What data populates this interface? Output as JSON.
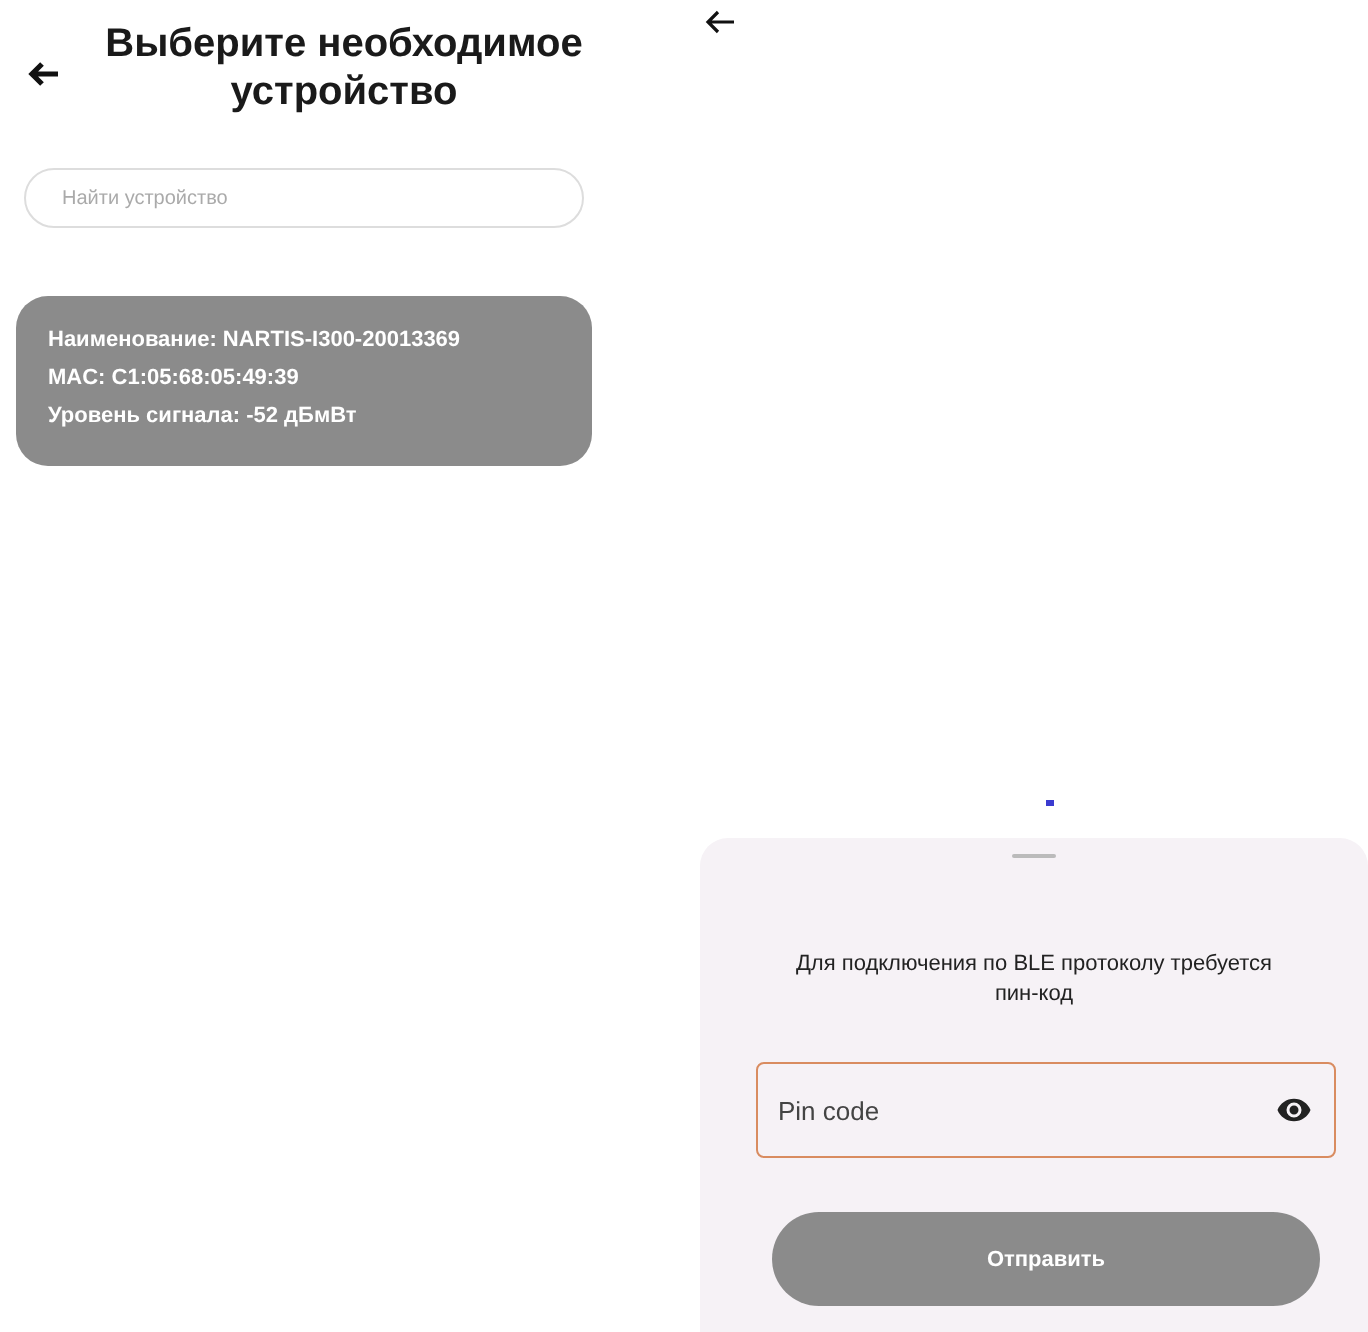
{
  "device_list_screen": {
    "title": "Выберите необходимое устройство",
    "search": {
      "placeholder": "Найти устройство"
    },
    "devices": [
      {
        "lines": [
          "Наименование: NARTIS-I300-20013369",
          "MAC: C1:05:68:05:49:39",
          "Уровень сигнала: -52 дБмВт"
        ]
      }
    ]
  },
  "pin_screen": {
    "sheet": {
      "message": "Для подключения по BLE протоколу требуется пин-код",
      "pin_field": {
        "placeholder": "Pin code",
        "focused": true
      },
      "submit_button": {
        "label": "Отправить",
        "disabled": true
      }
    }
  }
}
